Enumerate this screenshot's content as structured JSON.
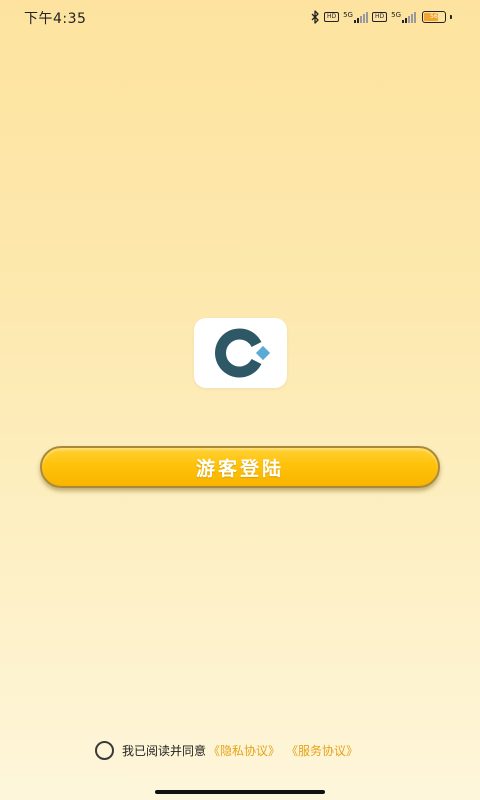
{
  "status_bar": {
    "time": "下午4:35",
    "icons": [
      "bluetooth-icon",
      "hd-icon",
      "signal-5g-icon",
      "hd-icon",
      "signal-5g-icon",
      "battery-icon"
    ],
    "hd_badge_1": "HD",
    "network_1": "5G",
    "hd_badge_2": "HD",
    "network_2": "5G",
    "battery_level": "56"
  },
  "logo": {
    "icon": "app-logo-c-diamond-icon",
    "colors": {
      "ring": "#2e5866",
      "diamond": "#5aa9d6",
      "background": "#ffffff"
    }
  },
  "login": {
    "guest_button_label": "游客登陆",
    "button_color": "#ffc20a"
  },
  "agreement": {
    "prefix": "我已阅读并同意",
    "privacy_link": "《隐私协议》",
    "service_link": "《服务协议》",
    "link_color": "#e6a21a",
    "checked": false
  },
  "theme": {
    "background_top": "#fde39f",
    "background_bottom": "#fef6db"
  }
}
